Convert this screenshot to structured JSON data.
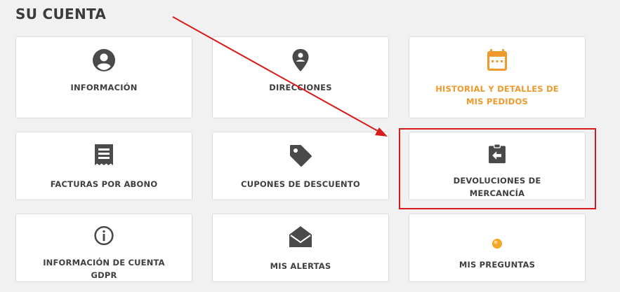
{
  "page": {
    "title": "SU CUENTA"
  },
  "colors": {
    "icon": "#4a4a4a",
    "accent": "#ee9a2c",
    "annotation": "#d71a1a"
  },
  "cards": [
    {
      "label": "INFORMACIÓN",
      "icon": "user-circle-icon"
    },
    {
      "label": "DIRECCIONES",
      "icon": "map-marker-icon"
    },
    {
      "label": "HISTORIAL Y DETALLES DE MIS PEDIDOS",
      "icon": "calendar-icon",
      "highlighted": true
    },
    {
      "label": "FACTURAS POR ABONO",
      "icon": "receipt-icon"
    },
    {
      "label": "CUPONES DE DESCUENTO",
      "icon": "tag-icon"
    },
    {
      "label": "DEVOLUCIONES DE MERCANCÍA",
      "icon": "clipboard-return-icon"
    },
    {
      "label": "INFORMACIÓN DE CUENTA GDPR",
      "icon": "info-circle-icon"
    },
    {
      "label": "MIS ALERTAS",
      "icon": "envelope-open-icon"
    },
    {
      "label": "MIS PREGUNTAS",
      "icon": "orange-dot-icon"
    }
  ]
}
